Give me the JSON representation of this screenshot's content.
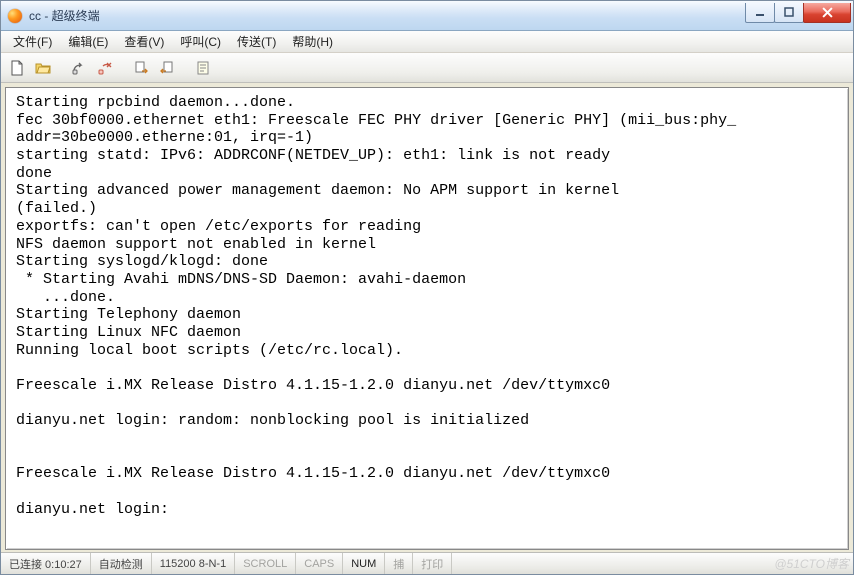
{
  "window": {
    "title": "cc - 超级终端"
  },
  "menu": {
    "items": [
      "文件(F)",
      "编辑(E)",
      "查看(V)",
      "呼叫(C)",
      "传送(T)",
      "帮助(H)"
    ]
  },
  "toolbar": {
    "icons": [
      "new-file-icon",
      "open-file-icon",
      "connect-icon",
      "disconnect-icon",
      "send-icon",
      "receive-icon",
      "properties-icon"
    ]
  },
  "terminal": {
    "lines": [
      "Starting rpcbind daemon...done.",
      "fec 30bf0000.ethernet eth1: Freescale FEC PHY driver [Generic PHY] (mii_bus:phy_",
      "addr=30be0000.etherne:01, irq=-1)",
      "starting statd: IPv6: ADDRCONF(NETDEV_UP): eth1: link is not ready",
      "done",
      "Starting advanced power management daemon: No APM support in kernel",
      "(failed.)",
      "exportfs: can't open /etc/exports for reading",
      "NFS daemon support not enabled in kernel",
      "Starting syslogd/klogd: done",
      " * Starting Avahi mDNS/DNS-SD Daemon: avahi-daemon",
      "   ...done.",
      "Starting Telephony daemon",
      "Starting Linux NFC daemon",
      "Running local boot scripts (/etc/rc.local).",
      "",
      "Freescale i.MX Release Distro 4.1.15-1.2.0 dianyu.net /dev/ttymxc0",
      "",
      "dianyu.net login: random: nonblocking pool is initialized",
      "",
      "",
      "Freescale i.MX Release Distro 4.1.15-1.2.0 dianyu.net /dev/ttymxc0",
      "",
      "dianyu.net login:"
    ]
  },
  "status": {
    "connected": "已连接 0:10:27",
    "auto": "自动检测",
    "params": "115200 8-N-1",
    "scroll": "SCROLL",
    "caps": "CAPS",
    "num": "NUM",
    "capture": "捕",
    "print": "打印"
  },
  "watermark": "@51CTO博客"
}
